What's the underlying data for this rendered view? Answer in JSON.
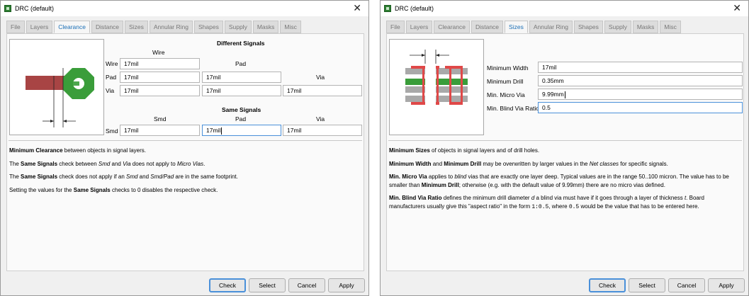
{
  "clearance_window": {
    "title": "DRC (default)",
    "tabs": [
      "File",
      "Layers",
      "Clearance",
      "Distance",
      "Sizes",
      "Annular Ring",
      "Shapes",
      "Supply",
      "Masks",
      "Misc"
    ],
    "active_tab": "Clearance",
    "different_signals": {
      "heading": "Different Signals",
      "col_wire": "Wire",
      "col_pad": "Pad",
      "col_via": "Via",
      "row_wire": "Wire",
      "row_pad": "Pad",
      "row_via": "Via",
      "wire_wire": "17mil",
      "pad_wire": "17mil",
      "pad_pad": "17mil",
      "via_wire": "17mil",
      "via_pad": "17mil",
      "via_via": "17mil"
    },
    "same_signals": {
      "heading": "Same Signals",
      "col_smd": "Smd",
      "col_pad": "Pad",
      "col_via": "Via",
      "row_smd": "Smd",
      "smd_smd": "17mil",
      "smd_pad": "17mil",
      "smd_via": "17mil"
    },
    "help": {
      "p1_b": "Minimum Clearance",
      "p1_t": " between objects in signal layers.",
      "p2_a": "The ",
      "p2_b": "Same Signals",
      "p2_c": " check between ",
      "p2_i1": "Smd",
      "p2_d": " and ",
      "p2_i2": "Via",
      "p2_e": " does not apply to ",
      "p2_i3": "Micro Vias",
      "p2_f": ".",
      "p3_a": "The ",
      "p3_b": "Same Signals",
      "p3_c": " check does not apply if an ",
      "p3_i1": "Smd",
      "p3_d": " and ",
      "p3_i2": "Smd/Pad",
      "p3_e": " are in the same footprint.",
      "p4_a": "Setting the values for the ",
      "p4_b": "Same Signals",
      "p4_c": " checks to 0 disables the respective check."
    }
  },
  "sizes_window": {
    "title": "DRC (default)",
    "tabs": [
      "File",
      "Layers",
      "Clearance",
      "Distance",
      "Sizes",
      "Annular Ring",
      "Shapes",
      "Supply",
      "Masks",
      "Misc"
    ],
    "active_tab": "Sizes",
    "fields": {
      "min_width_label": "Minimum Width",
      "min_width": "17mil",
      "min_drill_label": "Minimum Drill",
      "min_drill": "0.35mm",
      "min_micro_via_label": "Min. Micro Via",
      "min_micro_via": "9.99mm",
      "min_blind_label": "Min. Blind Via Ratio",
      "min_blind": "0.5"
    },
    "help": {
      "p1_b": "Minimum Sizes",
      "p1_t": " of objects in signal layers and of drill holes.",
      "p2_b1": "Minimum Width",
      "p2_a": " and ",
      "p2_b2": "Minimum Drill",
      "p2_c": " may be overwritten by larger values in the ",
      "p2_i": "Net classes",
      "p2_d": " for specific signals.",
      "p3_b": "Min. Micro Via",
      "p3_a": " applies to ",
      "p3_i": "blind",
      "p3_c": " vias that are exactly one layer deep. Typical values are in the range 50..100 micron. The value has to be smaller than ",
      "p3_b2": "Minimum Drill",
      "p3_d": "; otherwise (e.g. with the default value of 9.99mm) there are no micro vias defined.",
      "p4_b": "Min. Blind Via Ratio",
      "p4_a": " defines the minimum drill diameter ",
      "p4_i1": "d",
      "p4_c": " a blind via must have if it goes through a layer of thickness ",
      "p4_i2": "t",
      "p4_d": ". Board manufacturers usually give this \"aspect ratio\" in the form ",
      "p4_m1": "1:0.5",
      "p4_e": ", where ",
      "p4_m2": "0.5",
      "p4_f": " would be the value that has to be entered here."
    }
  },
  "buttons": {
    "check": "Check",
    "select": "Select",
    "cancel": "Cancel",
    "apply": "Apply"
  },
  "colors": {
    "active_tab_text": "#1b6fb6",
    "focus_border": "#4a90d9",
    "wire": "#a84444",
    "pad": "#3a9d3a"
  }
}
